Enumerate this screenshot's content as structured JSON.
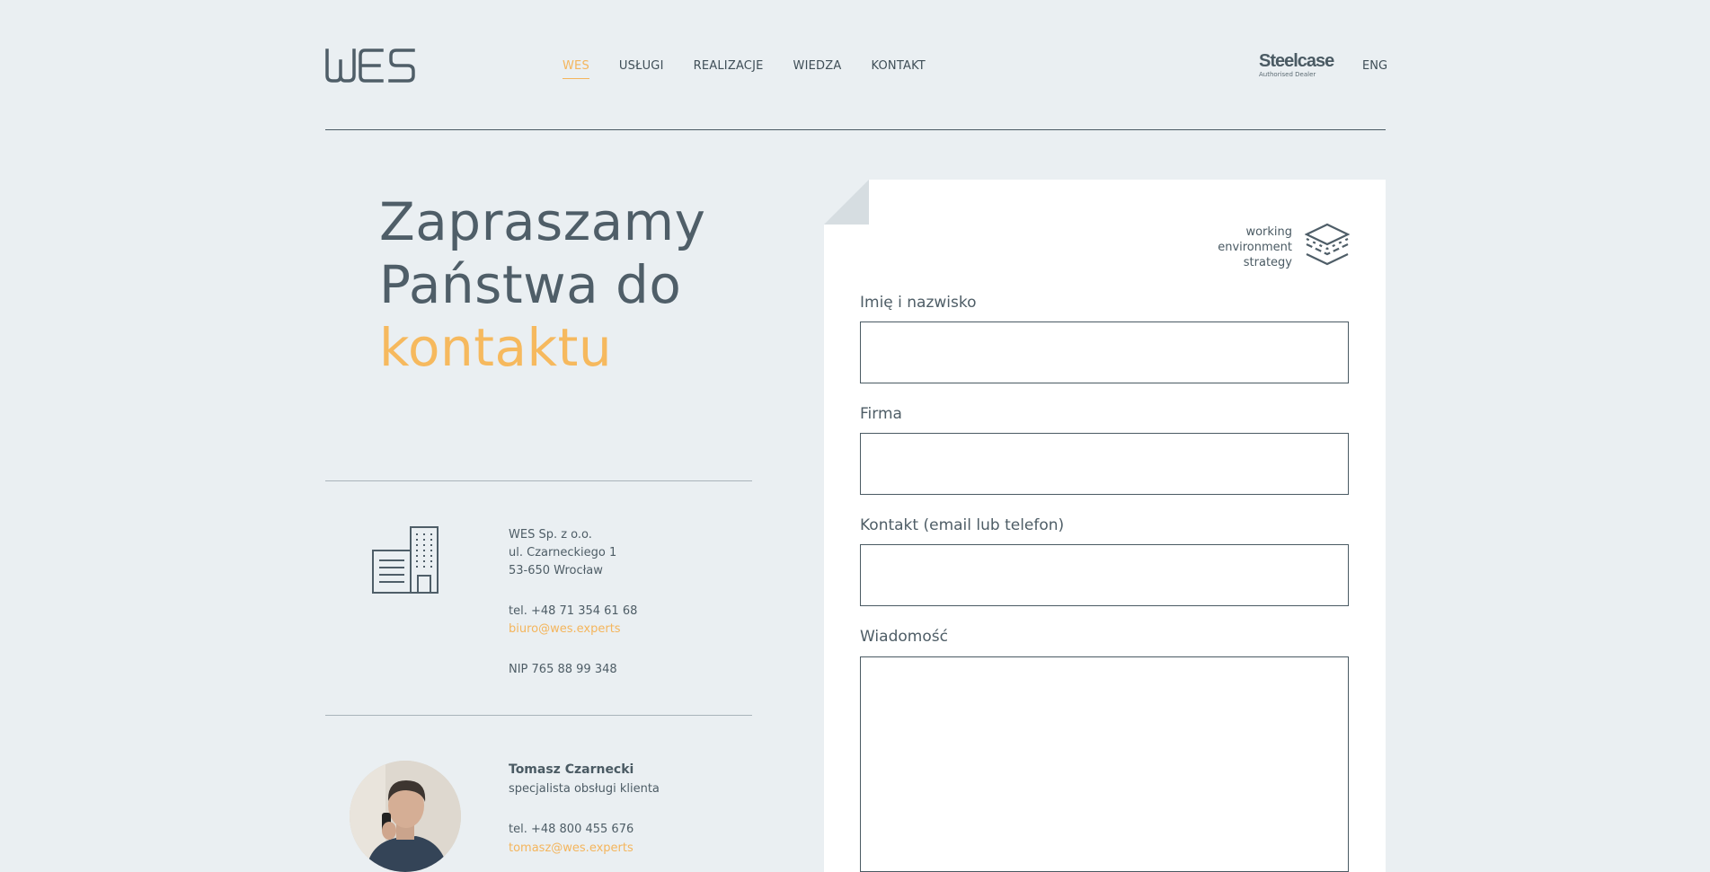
{
  "header": {
    "logo_text": "WES",
    "nav": [
      {
        "label": "WES",
        "active": true
      },
      {
        "label": "USŁUGI",
        "active": false
      },
      {
        "label": "REALIZACJE",
        "active": false
      },
      {
        "label": "WIEDZA",
        "active": false
      },
      {
        "label": "KONTAKT",
        "active": false
      }
    ],
    "partner": {
      "name": "Steelcase",
      "subtitle": "Authorised Dealer"
    },
    "language": "ENG"
  },
  "hero": {
    "line1": "Zapraszamy",
    "line2": "Państwa do",
    "line3": "kontaktu"
  },
  "company": {
    "name": "WES Sp. z o.o.",
    "street": "ul. Czarneckiego 1",
    "city": "53-650 Wrocław",
    "phone": "tel. +48 71 354 61 68",
    "email": "biuro@wes.experts",
    "nip": "NIP 765 88 99 348"
  },
  "contact_person": {
    "name": "Tomasz Czarnecki",
    "role": "specjalista obsługi klienta",
    "phone": "tel. +48 800 455 676",
    "email": "tomasz@wes.experts"
  },
  "form": {
    "badge": [
      "working",
      "environment",
      "strategy"
    ],
    "fields": [
      {
        "label": "Imię i nazwisko",
        "value": ""
      },
      {
        "label": "Firma",
        "value": ""
      },
      {
        "label": "Kontakt (email lub telefon)",
        "value": ""
      },
      {
        "label": "Wiadomość",
        "value": ""
      }
    ]
  },
  "colors": {
    "accent": "#f4b55c",
    "text": "#4a5a63",
    "background": "#eaeff2"
  }
}
